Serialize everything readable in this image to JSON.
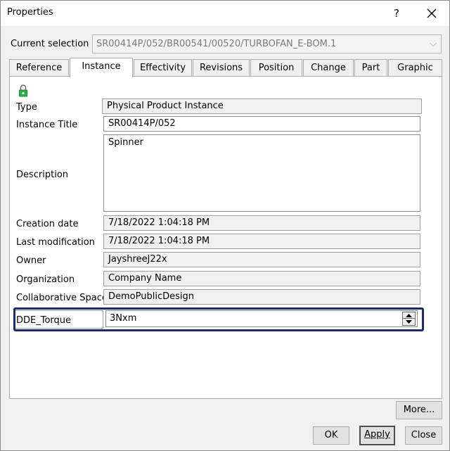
{
  "window": {
    "title": "Properties",
    "help_label": "?"
  },
  "selection": {
    "label": "Current selection :",
    "value": "SR00414P/052/BR00541/00520/TURBOFAN_E-BOM.1",
    "arrow": "⌵"
  },
  "tabs": [
    {
      "label": "Reference",
      "active": false
    },
    {
      "label": "Instance",
      "active": true
    },
    {
      "label": "Effectivity",
      "active": false
    },
    {
      "label": "Revisions",
      "active": false
    },
    {
      "label": "Position",
      "active": false
    },
    {
      "label": "Change",
      "active": false
    },
    {
      "label": "Part",
      "active": false
    },
    {
      "label": "Graphic",
      "active": false
    }
  ],
  "fields": {
    "type": {
      "label": "Type",
      "value": "Physical Product Instance"
    },
    "instance_title": {
      "label": "Instance Title",
      "value": "SR00414P/052"
    },
    "description": {
      "label": "Description",
      "value": "Spinner"
    },
    "creation_date": {
      "label": "Creation date",
      "value": "7/18/2022 1:04:18 PM"
    },
    "last_modification": {
      "label": "Last modification",
      "value": "7/18/2022 1:04:18 PM"
    },
    "owner": {
      "label": "Owner",
      "value": "JayshreeJ22x"
    },
    "organization": {
      "label": "Organization",
      "value": "Company Name"
    },
    "collaborative_space": {
      "label": "Collaborative Space",
      "value": "DemoPublicDesign"
    },
    "dde_torque": {
      "label": "DDE_Torque",
      "value": "3Nxm"
    }
  },
  "buttons": {
    "more": "More...",
    "ok": "OK",
    "apply": "Apply",
    "close": "Close"
  },
  "colors": {
    "highlight": "#1d2a6b",
    "lock_icon": "#2db34a"
  },
  "icons": {
    "lock": "lock-icon",
    "close": "close-icon",
    "spin_up": "spin-up-icon",
    "spin_down": "spin-down-icon"
  }
}
